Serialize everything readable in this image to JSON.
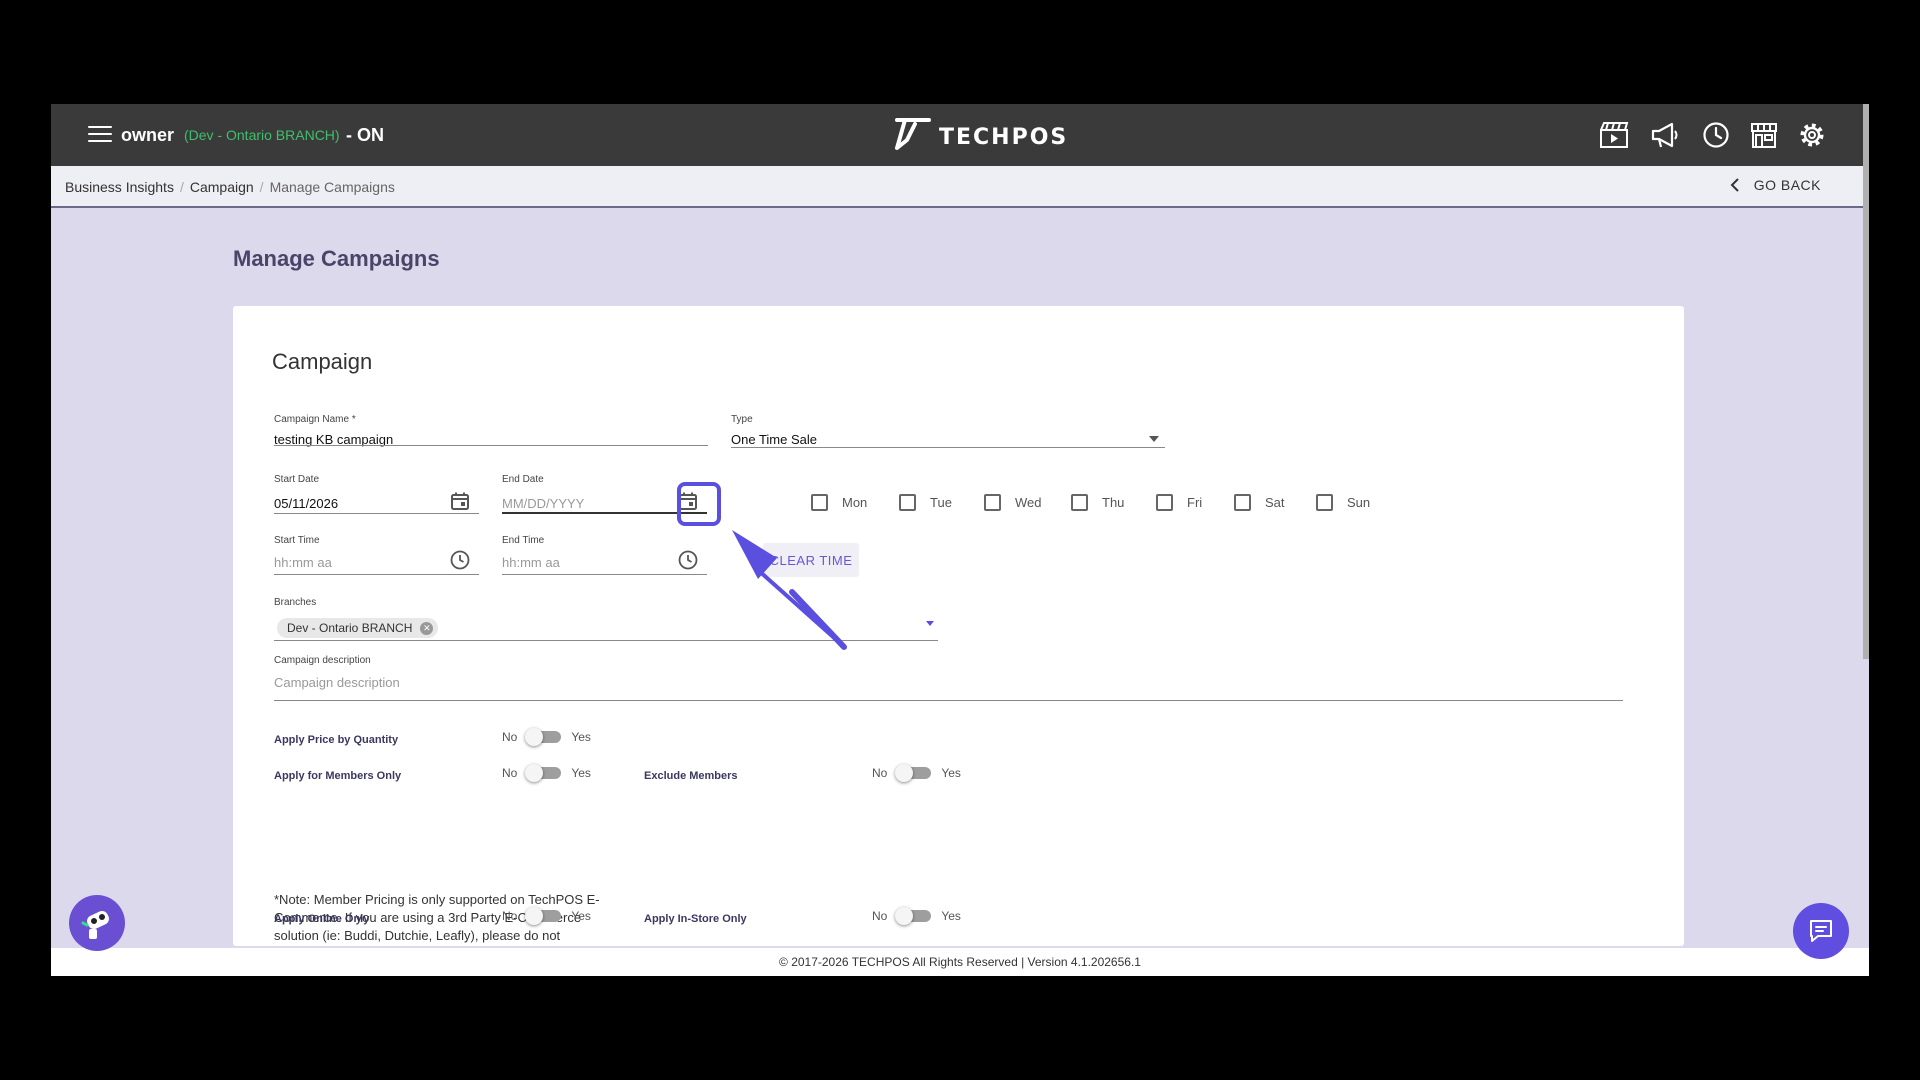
{
  "topbar": {
    "user": "owner",
    "branch": "(Dev - Ontario BRANCH)",
    "status": "- ON",
    "logo_text": "TECHPOS",
    "icons": [
      "clapperboard-icon",
      "megaphone-icon",
      "clock-icon",
      "store-icon",
      "gear-icon"
    ]
  },
  "breadcrumb": {
    "items": [
      "Business Insights",
      "Campaign",
      "Manage Campaigns"
    ],
    "go_back": "GO BACK"
  },
  "page": {
    "title": "Manage Campaigns",
    "card_title": "Campaign"
  },
  "form": {
    "campaign_name": {
      "label": "Campaign Name *",
      "value": "testing KB campaign"
    },
    "type": {
      "label": "Type",
      "value": "One Time Sale"
    },
    "start_date": {
      "label": "Start Date",
      "value": "05/11/2026"
    },
    "end_date": {
      "label": "End Date",
      "placeholder": "MM/DD/YYYY"
    },
    "start_time": {
      "label": "Start Time",
      "placeholder": "hh:mm aa"
    },
    "end_time": {
      "label": "End Time",
      "placeholder": "hh:mm aa"
    },
    "days": [
      "Mon",
      "Tue",
      "Wed",
      "Thu",
      "Fri",
      "Sat",
      "Sun"
    ],
    "clear_time": "CLEAR TIME",
    "branches": {
      "label": "Branches",
      "chip": "Dev - Ontario BRANCH"
    },
    "description": {
      "label": "Campaign description",
      "placeholder": "Campaign description"
    }
  },
  "toggles": {
    "no": "No",
    "yes": "Yes",
    "price_by_quantity": "Apply Price by Quantity",
    "members_only": "Apply for Members Only",
    "exclude_members": "Exclude Members",
    "online_only": "Apply Online Only",
    "in_store_only": "Apply In-Store Only"
  },
  "note": "*Note: Member Pricing is only supported on TechPOS E-Commerce. If you are using a 3rd Party E-Commerce solution (ie: Buddi, Dutchie, Leafly), please do not activate the \"Apply for Members Only\" option.",
  "footer": "© 2017-2026 TECHPOS All Rights Reserved | Version 4.1.202656.1",
  "colors": {
    "topbar": "#3a3a3a",
    "background": "#dcd9ec",
    "accent": "#5b4fe0",
    "branch_text": "#3fbf6a"
  }
}
